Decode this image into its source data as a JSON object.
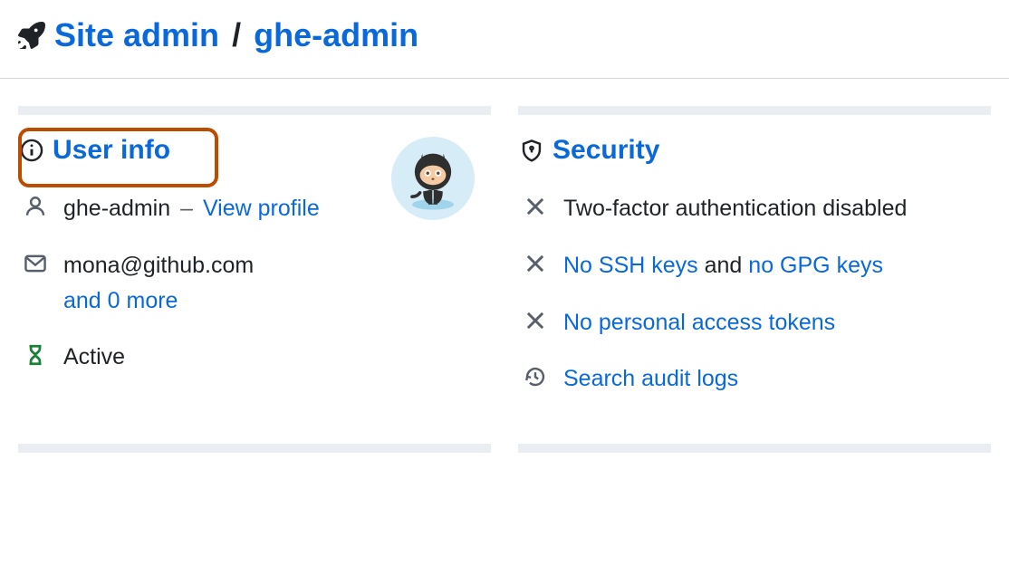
{
  "breadcrumb": {
    "site_admin": "Site admin",
    "sep": "/",
    "user": "ghe-admin"
  },
  "user_info": {
    "heading": "User info",
    "username": "ghe-admin",
    "dash": "–",
    "view_profile": "View profile",
    "email": "mona@github.com",
    "email_more": "and 0 more",
    "status": "Active"
  },
  "security": {
    "heading": "Security",
    "two_factor": "Two-factor authentication disabled",
    "no_ssh": "No SSH keys",
    "and_word": "and",
    "no_gpg": "no GPG keys",
    "no_pat": "No personal access tokens",
    "audit": "Search audit logs"
  }
}
